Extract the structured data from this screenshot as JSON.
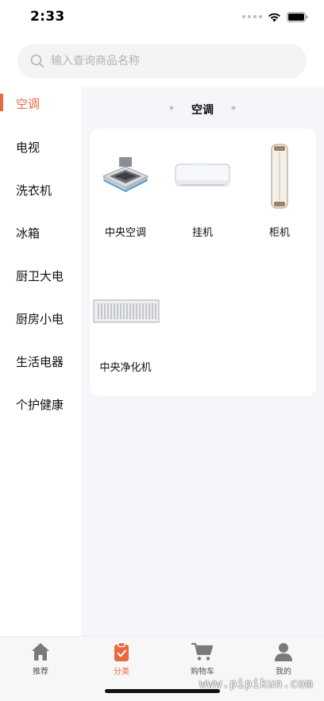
{
  "status_bar": {
    "time": "2:33",
    "icons": [
      "signal-dots-icon",
      "wifi-icon",
      "battery-icon"
    ]
  },
  "search": {
    "placeholder": "输入查询商品名称",
    "icon": "search-icon"
  },
  "sidebar": {
    "items": [
      {
        "label": "空调",
        "active": true
      },
      {
        "label": "电视",
        "active": false
      },
      {
        "label": "洗衣机",
        "active": false
      },
      {
        "label": "冰箱",
        "active": false
      },
      {
        "label": "厨卫大电",
        "active": false
      },
      {
        "label": "厨房小电",
        "active": false
      },
      {
        "label": "生活电器",
        "active": false
      },
      {
        "label": "个护健康",
        "active": false
      }
    ]
  },
  "content": {
    "heading": "空调",
    "heading_marker": "*",
    "products": [
      {
        "label": "中央空调",
        "icon": "ceiling-cassette-ac-icon"
      },
      {
        "label": "挂机",
        "icon": "wall-mounted-ac-icon"
      },
      {
        "label": "柜机",
        "icon": "floor-standing-ac-icon"
      },
      {
        "label": "中央净化机",
        "icon": "air-purifier-unit-icon"
      }
    ]
  },
  "tabbar": {
    "tabs": [
      {
        "label": "推荐",
        "icon": "home-icon",
        "active": false
      },
      {
        "label": "分类",
        "icon": "category-clipboard-icon",
        "active": true
      },
      {
        "label": "购物车",
        "icon": "cart-icon",
        "active": false
      },
      {
        "label": "我的",
        "icon": "user-icon",
        "active": false
      }
    ]
  },
  "watermark": "www.pipikun.com",
  "colors": {
    "accent": "#e86a43",
    "content_background": "#f6f6fa",
    "search_background": "#f4f4f6"
  }
}
